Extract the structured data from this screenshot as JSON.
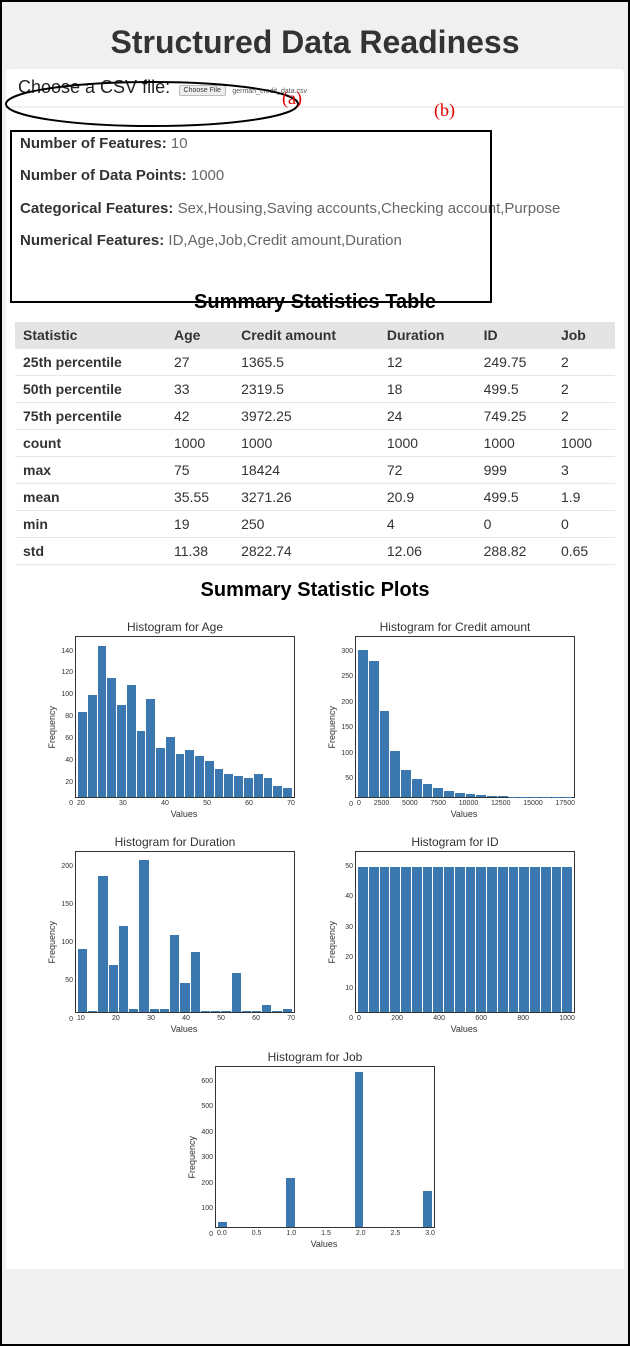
{
  "header": {
    "title": "Structured Data Readiness"
  },
  "file_picker": {
    "label": "Choose a CSV file:",
    "button_label": "Choose File",
    "chosen_filename": "german_credit_data.csv"
  },
  "annotations": {
    "a": "(a)",
    "b": "(b)"
  },
  "info": {
    "num_features_label": "Number of Features:",
    "num_features_value": "10",
    "num_points_label": "Number of Data Points:",
    "num_points_value": "1000",
    "categorical_label": "Categorical Features:",
    "categorical_value": "Sex,Housing,Saving accounts,Checking account,Purpose",
    "numerical_label": "Numerical Features:",
    "numerical_value": "ID,Age,Job,Credit amount,Duration"
  },
  "stats_table": {
    "title": "Summary Statistics Table",
    "columns": [
      "Statistic",
      "Age",
      "Credit amount",
      "Duration",
      "ID",
      "Job"
    ],
    "rows": [
      [
        "25th percentile",
        "27",
        "1365.5",
        "12",
        "249.75",
        "2"
      ],
      [
        "50th percentile",
        "33",
        "2319.5",
        "18",
        "499.5",
        "2"
      ],
      [
        "75th percentile",
        "42",
        "3972.25",
        "24",
        "749.25",
        "2"
      ],
      [
        "count",
        "1000",
        "1000",
        "1000",
        "1000",
        "1000"
      ],
      [
        "max",
        "75",
        "18424",
        "72",
        "999",
        "3"
      ],
      [
        "mean",
        "35.55",
        "3271.26",
        "20.9",
        "499.5",
        "1.9"
      ],
      [
        "min",
        "19",
        "250",
        "4",
        "0",
        "0"
      ],
      [
        "std",
        "11.38",
        "2822.74",
        "12.06",
        "288.82",
        "0.65"
      ]
    ]
  },
  "plots_section": {
    "title": "Summary Statistic Plots",
    "xaxis_label": "Values",
    "yaxis_label": "Frequency"
  },
  "chart_data": [
    {
      "type": "bar",
      "title": "Histogram for Age",
      "xlabel": "Values",
      "ylabel": "Frequency",
      "xticks": [
        "20",
        "30",
        "40",
        "50",
        "60",
        "70"
      ],
      "yticks": [
        "0",
        "20",
        "40",
        "60",
        "80",
        "100",
        "120",
        "140"
      ],
      "xlim": [
        19,
        75
      ],
      "ylim": [
        0,
        150
      ],
      "values": [
        80,
        96,
        142,
        112,
        86,
        105,
        62,
        92,
        46,
        56,
        40,
        44,
        38,
        34,
        26,
        22,
        20,
        18,
        22,
        18,
        10,
        8
      ]
    },
    {
      "type": "bar",
      "title": "Histogram for Credit amount",
      "xlabel": "Values",
      "ylabel": "Frequency",
      "xticks": [
        "0",
        "2500",
        "5000",
        "7500",
        "10000",
        "12500",
        "15000",
        "17500"
      ],
      "yticks": [
        "0",
        "50",
        "100",
        "150",
        "200",
        "250",
        "300"
      ],
      "xlim": [
        0,
        18500
      ],
      "ylim": [
        0,
        320
      ],
      "values": [
        294,
        272,
        172,
        92,
        54,
        36,
        26,
        18,
        12,
        8,
        6,
        4,
        3,
        2,
        1,
        1,
        1,
        1,
        1,
        1
      ]
    },
    {
      "type": "bar",
      "title": "Histogram for Duration",
      "xlabel": "Values",
      "ylabel": "Frequency",
      "xticks": [
        "10",
        "20",
        "30",
        "40",
        "50",
        "60",
        "70"
      ],
      "yticks": [
        "0",
        "50",
        "100",
        "150",
        "200"
      ],
      "xlim": [
        4,
        72
      ],
      "ylim": [
        0,
        230
      ],
      "values": [
        90,
        2,
        196,
        68,
        124,
        4,
        218,
        4,
        4,
        110,
        42,
        86,
        2,
        2,
        2,
        56,
        2,
        2,
        10,
        2,
        4
      ]
    },
    {
      "type": "bar",
      "title": "Histogram for ID",
      "xlabel": "Values",
      "ylabel": "Frequency",
      "xticks": [
        "0",
        "200",
        "400",
        "600",
        "800",
        "1000"
      ],
      "yticks": [
        "0",
        "10",
        "20",
        "30",
        "40",
        "50"
      ],
      "xlim": [
        0,
        1000
      ],
      "ylim": [
        0,
        55
      ],
      "values": [
        50,
        50,
        50,
        50,
        50,
        50,
        50,
        50,
        50,
        50,
        50,
        50,
        50,
        50,
        50,
        50,
        50,
        50,
        50,
        50
      ]
    },
    {
      "type": "bar",
      "title": "Histogram for Job",
      "xlabel": "Values",
      "ylabel": "Frequency",
      "xticks": [
        "0.0",
        "0.5",
        "1.0",
        "1.5",
        "2.0",
        "2.5",
        "3.0"
      ],
      "yticks": [
        "0",
        "100",
        "200",
        "300",
        "400",
        "500",
        "600"
      ],
      "xlim": [
        0,
        3
      ],
      "ylim": [
        0,
        650
      ],
      "values": [
        22,
        0,
        0,
        0,
        0,
        0,
        0,
        200,
        0,
        0,
        0,
        0,
        0,
        0,
        630,
        0,
        0,
        0,
        0,
        0,
        0,
        148
      ]
    }
  ]
}
